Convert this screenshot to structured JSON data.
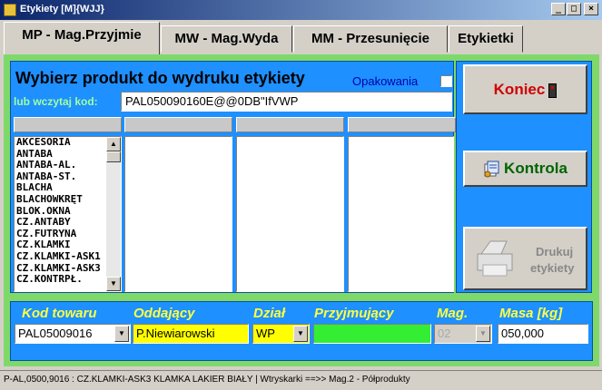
{
  "window": {
    "title": "Etykiety [M]{WJJ}",
    "controls": {
      "minimize": "_",
      "maximize": "□",
      "close": "×"
    }
  },
  "tabs": [
    {
      "label": "MP - Mag.Przyjmie",
      "active": true
    },
    {
      "label": "MW - Mag.Wyda",
      "active": false
    },
    {
      "label": "MM - Przesunięcie",
      "active": false
    },
    {
      "label": "Etykietki",
      "active": false
    }
  ],
  "main": {
    "heading": "Wybierz produkt do wydruku etykiety",
    "packaging_label": "Opakowania",
    "packaging_checked": false,
    "scan_label": "lub wczytaj kod:",
    "scan_value": "PAL050090160E@@0DB\"IfVWP"
  },
  "product_list": [
    "AKCESORIA",
    "ANTABA",
    "ANTABA-AL.",
    "ANTABA-ST.",
    "BLACHA",
    "BLACHOWKRĘT",
    "BLOK.OKNA",
    "CZ.ANTABY",
    "CZ.FUTRYNA",
    "CZ.KLAMKI",
    "CZ.KLAMKI-ASK1",
    "CZ.KLAMKI-ASK3",
    "CZ.KONTRPŁ."
  ],
  "buttons": {
    "koniec": "Koniec",
    "kontrola": "Kontrola",
    "drukuj_line1": "Drukuj",
    "drukuj_line2": "etykiety"
  },
  "bottom": {
    "kod_towaru_label": "Kod towaru",
    "kod_towaru_value": "PAL05009016",
    "oddajacy_label": "Oddający",
    "oddajacy_value": "P.Niewiarowski",
    "dzial_label": "Dział",
    "dzial_value": "WP",
    "przyjmujacy_label": "Przyjmujący",
    "przyjmujacy_value": "",
    "mag_label": "Mag.",
    "mag_value": "02",
    "masa_label": "Masa [kg]",
    "masa_value": "050,000"
  },
  "status": {
    "text": "P-AL,0500,9016 : CZ.KLAMKI-ASK3 KLAMKA LAKIER BIAŁY | Wtryskarki ==>> Mag.2 - Półprodukty"
  },
  "colors": {
    "panel_green": "#7fd96a",
    "panel_blue": "#1e90ff",
    "field_yellow": "#ffff00",
    "field_green": "#33ee33",
    "koniec_red": "#d00000",
    "kontrola_green": "#006400"
  }
}
